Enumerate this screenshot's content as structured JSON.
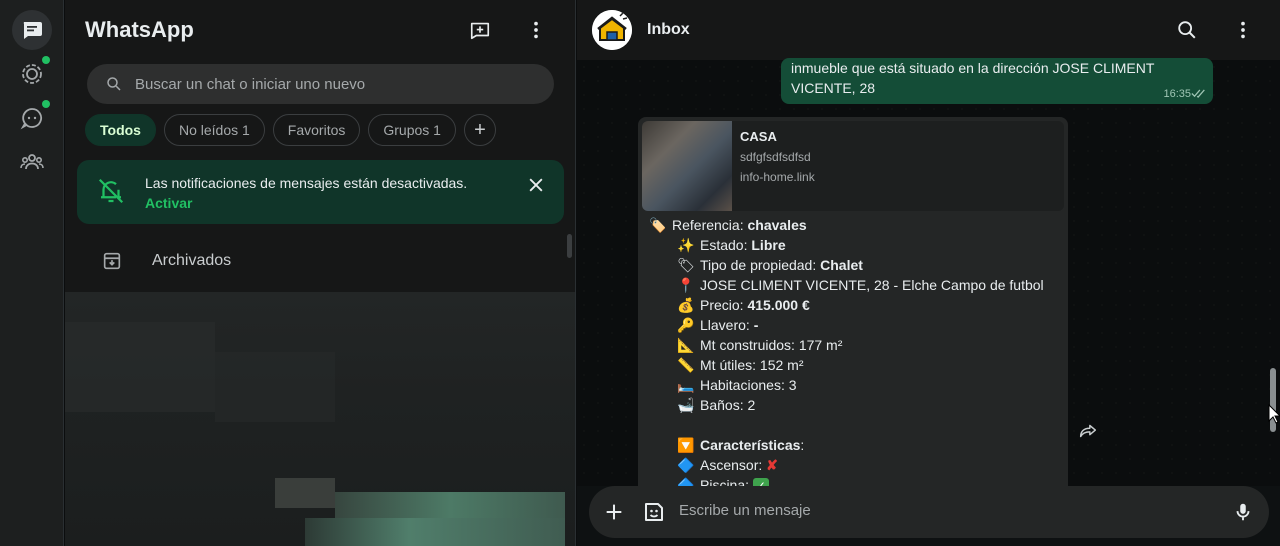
{
  "app_title": "WhatsApp",
  "rail": {
    "items": [
      {
        "icon": "chats-icon",
        "active": true
      },
      {
        "icon": "status-icon",
        "badge": true
      },
      {
        "icon": "channels-icon",
        "badge": true
      },
      {
        "icon": "communities-icon"
      }
    ]
  },
  "search": {
    "placeholder": "Buscar un chat o iniciar uno nuevo",
    "value": ""
  },
  "filters": [
    "Todos",
    "No leídos 1",
    "Favoritos",
    "Grupos 1"
  ],
  "notice": {
    "text": "Las notificaciones de mensajes están desactivadas.",
    "link": "Activar"
  },
  "archived": {
    "label": "Archivados"
  },
  "chat": {
    "name": "Inbox",
    "outgoing": {
      "lines": [
        "inmueble que está situado en la dirección JOSE CLIMENT",
        "VICENTE, 28"
      ],
      "time": "16:35"
    },
    "preview": {
      "title": "CASA",
      "description": "sdfgfsdfsdfsd",
      "site": "info-home.link"
    },
    "message": {
      "ref_label": "Referencia: ",
      "ref_value": "chavales",
      "estado_label": "Estado: ",
      "estado_value": "Libre",
      "tipo_label": "Tipo de propiedad: ",
      "tipo_value": "Chalet",
      "address": "JOSE CLIMENT VICENTE, 28 - Elche Campo de futbol",
      "precio_label": "Precio: ",
      "precio_value": "415.000 €",
      "llavero_label": "Llavero: ",
      "llavero_value": "-",
      "construidos": "Mt construidos: 177 m²",
      "utiles": "Mt útiles: 152 m²",
      "habitaciones": "Habitaciones: 3",
      "banos": "Baños: 2",
      "caracteristicas_label": "Características",
      "caracteristicas_suffix": ":",
      "ascensor": "Ascensor: ",
      "piscina": "Piscina: "
    }
  },
  "composer": {
    "placeholder": "Escribe un mensaje",
    "value": ""
  },
  "colors": {
    "accent": "#21c063",
    "bubble_out": "#144d37",
    "bubble_in": "#242626"
  }
}
